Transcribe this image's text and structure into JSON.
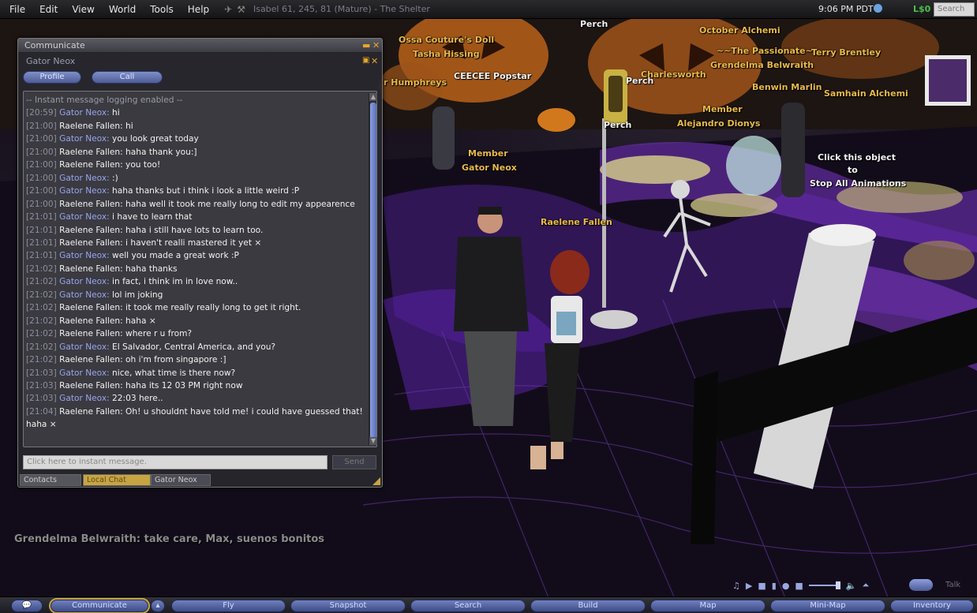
{
  "menu": {
    "items": [
      "File",
      "Edit",
      "View",
      "World",
      "Tools",
      "Help"
    ],
    "location": "Isabel 61, 245, 81 (Mature) - The Shelter",
    "clock": "9:06 PM PDT",
    "balance": "L$0",
    "search_placeholder": "Search"
  },
  "scene": {
    "tags": {
      "perch1": "Perch",
      "ossa": "Ossa Couture's Doll",
      "tasha": "Tasha Hissing",
      "humphreys": "r Humphreys",
      "ceecee": "CEECEE Popstar",
      "october": "October Alchemi",
      "passionate": "~~The Passionate~~",
      "grendelma": "Grendelma Belwraith",
      "terry": "Terry Brentley",
      "charlesworth": "Charlesworth",
      "perch2": "Perch",
      "benwin": "Benwin Marlin",
      "samhain": "Samhain Alchemi",
      "member1": "Member",
      "alejandro": "Alejandro Dionys",
      "perch3": "Perch",
      "member2": "Member",
      "gator_tag": "Gator Neox",
      "click_object": "Click this object",
      "to": "to",
      "stop_anim": "Stop All Animations",
      "raelene_tag": "Raelene Fallen"
    },
    "nearby_chat": "Grendelma Belwraith: take care, Max, suenos bonitos"
  },
  "communicate": {
    "title": "Communicate",
    "im_name": "Gator Neox",
    "profile_button": "Profile",
    "call_button": "Call",
    "input_placeholder": "Click here to instant message.",
    "send_button": "Send",
    "tabs": [
      "Contacts",
      "Local Chat",
      "Gator Neox"
    ],
    "log": [
      {
        "type": "system",
        "text": "-- Instant message logging enabled --"
      },
      {
        "ts": "[20:59]",
        "speaker": "Gator Neox",
        "text": "hi"
      },
      {
        "ts": "[21:00]",
        "speaker": "Raelene Fallen",
        "text": "hi"
      },
      {
        "ts": "[21:00]",
        "speaker": "Gator Neox",
        "text": "you look great today"
      },
      {
        "ts": "[21:00]",
        "speaker": "Raelene Fallen",
        "text": "haha thank you:]"
      },
      {
        "ts": "[21:00]",
        "speaker": "Raelene Fallen",
        "text": "you too!"
      },
      {
        "ts": "[21:00]",
        "speaker": "Gator Neox",
        "text": ":)"
      },
      {
        "ts": "[21:00]",
        "speaker": "Gator Neox",
        "text": "haha thanks but i think i look a little weird :P"
      },
      {
        "ts": "[21:00]",
        "speaker": "Raelene Fallen",
        "text": "haha well it took me really long to edit my appearence"
      },
      {
        "ts": "[21:01]",
        "speaker": "Gator Neox",
        "text": "i have to learn that"
      },
      {
        "ts": "[21:01]",
        "speaker": "Raelene Fallen",
        "text": "haha i still have lots to learn too."
      },
      {
        "ts": "[21:01]",
        "speaker": "Raelene Fallen",
        "text": "i haven't realli mastered it yet ×"
      },
      {
        "ts": "[21:01]",
        "speaker": "Gator Neox",
        "text": "well you made a great work :P"
      },
      {
        "ts": "[21:02]",
        "speaker": "Raelene Fallen",
        "text": "haha thanks"
      },
      {
        "ts": "[21:02]",
        "speaker": "Gator Neox",
        "text": "in fact, i think im in love now.."
      },
      {
        "ts": "[21:02]",
        "speaker": "Gator Neox",
        "text": "lol im joking"
      },
      {
        "ts": "[21:02]",
        "speaker": "Raelene Fallen",
        "text": "it took me really really long to get it right."
      },
      {
        "ts": "[21:02]",
        "speaker": "Raelene Fallen",
        "text": "haha ×"
      },
      {
        "ts": "[21:02]",
        "speaker": "Raelene Fallen",
        "text": "where r u from?"
      },
      {
        "ts": "[21:02]",
        "speaker": "Gator Neox",
        "text": "El Salvador, Central America, and you?"
      },
      {
        "ts": "[21:02]",
        "speaker": "Raelene Fallen",
        "text": "oh i'm from singapore :]"
      },
      {
        "ts": "[21:03]",
        "speaker": "Gator Neox",
        "text": "nice, what time is there now?"
      },
      {
        "ts": "[21:03]",
        "speaker": "Raelene Fallen",
        "text": "haha its 12 03 PM right now"
      },
      {
        "ts": "[21:03]",
        "speaker": "Gator Neox",
        "text": "22:03 here.."
      },
      {
        "ts": "[21:04]",
        "speaker": "Raelene Fallen",
        "text": "Oh! u shouldnt have told me! i could have guessed that! haha ×"
      }
    ]
  },
  "toolbar": {
    "communicate": "Communicate",
    "fly": "Fly",
    "snapshot": "Snapshot",
    "search": "Search",
    "build": "Build",
    "map": "Map",
    "mini_map": "Mini-Map",
    "inventory": "Inventory",
    "talk": "Talk"
  }
}
